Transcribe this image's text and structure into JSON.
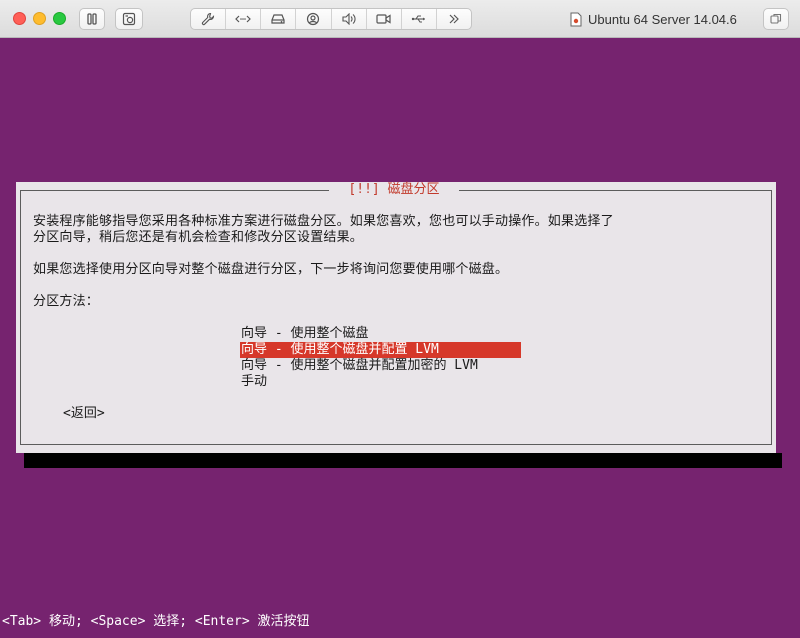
{
  "window": {
    "title": "Ubuntu 64 Server 14.04.6",
    "toolbar_icons": [
      "pause-icon",
      "snapshot-icon",
      "wrench-icon",
      "network-icon",
      "disk-icon",
      "camera-icon",
      "sound-icon",
      "video-icon",
      "usb-icon",
      "more-icon"
    ]
  },
  "dialog": {
    "title": "[!!] 磁盘分区",
    "paragraph1_line1": "安装程序能够指导您采用各种标准方案进行磁盘分区。如果您喜欢，您也可以手动操作。如果选择了",
    "paragraph1_line2": "分区向导，稍后您还是有机会检查和修改分区设置结果。",
    "paragraph2": "如果您选择使用分区向导对整个磁盘进行分区，下一步将询问您要使用哪个磁盘。",
    "method_label": "分区方法：",
    "options": [
      {
        "label": "向导 - 使用整个磁盘"
      },
      {
        "label": "向导 - 使用整个磁盘并配置 LVM"
      },
      {
        "label": "向导 - 使用整个磁盘并配置加密的 LVM"
      },
      {
        "label": "手动"
      }
    ],
    "back_label": "<返回>"
  },
  "statusbar": {
    "text": "<Tab> 移动; <Space> 选择; <Enter> 激活按钮"
  },
  "colors": {
    "background": "#76236f",
    "dialog_bg": "#e9e5e9",
    "highlight": "#d6382a",
    "title_text": "#c23a2c"
  }
}
